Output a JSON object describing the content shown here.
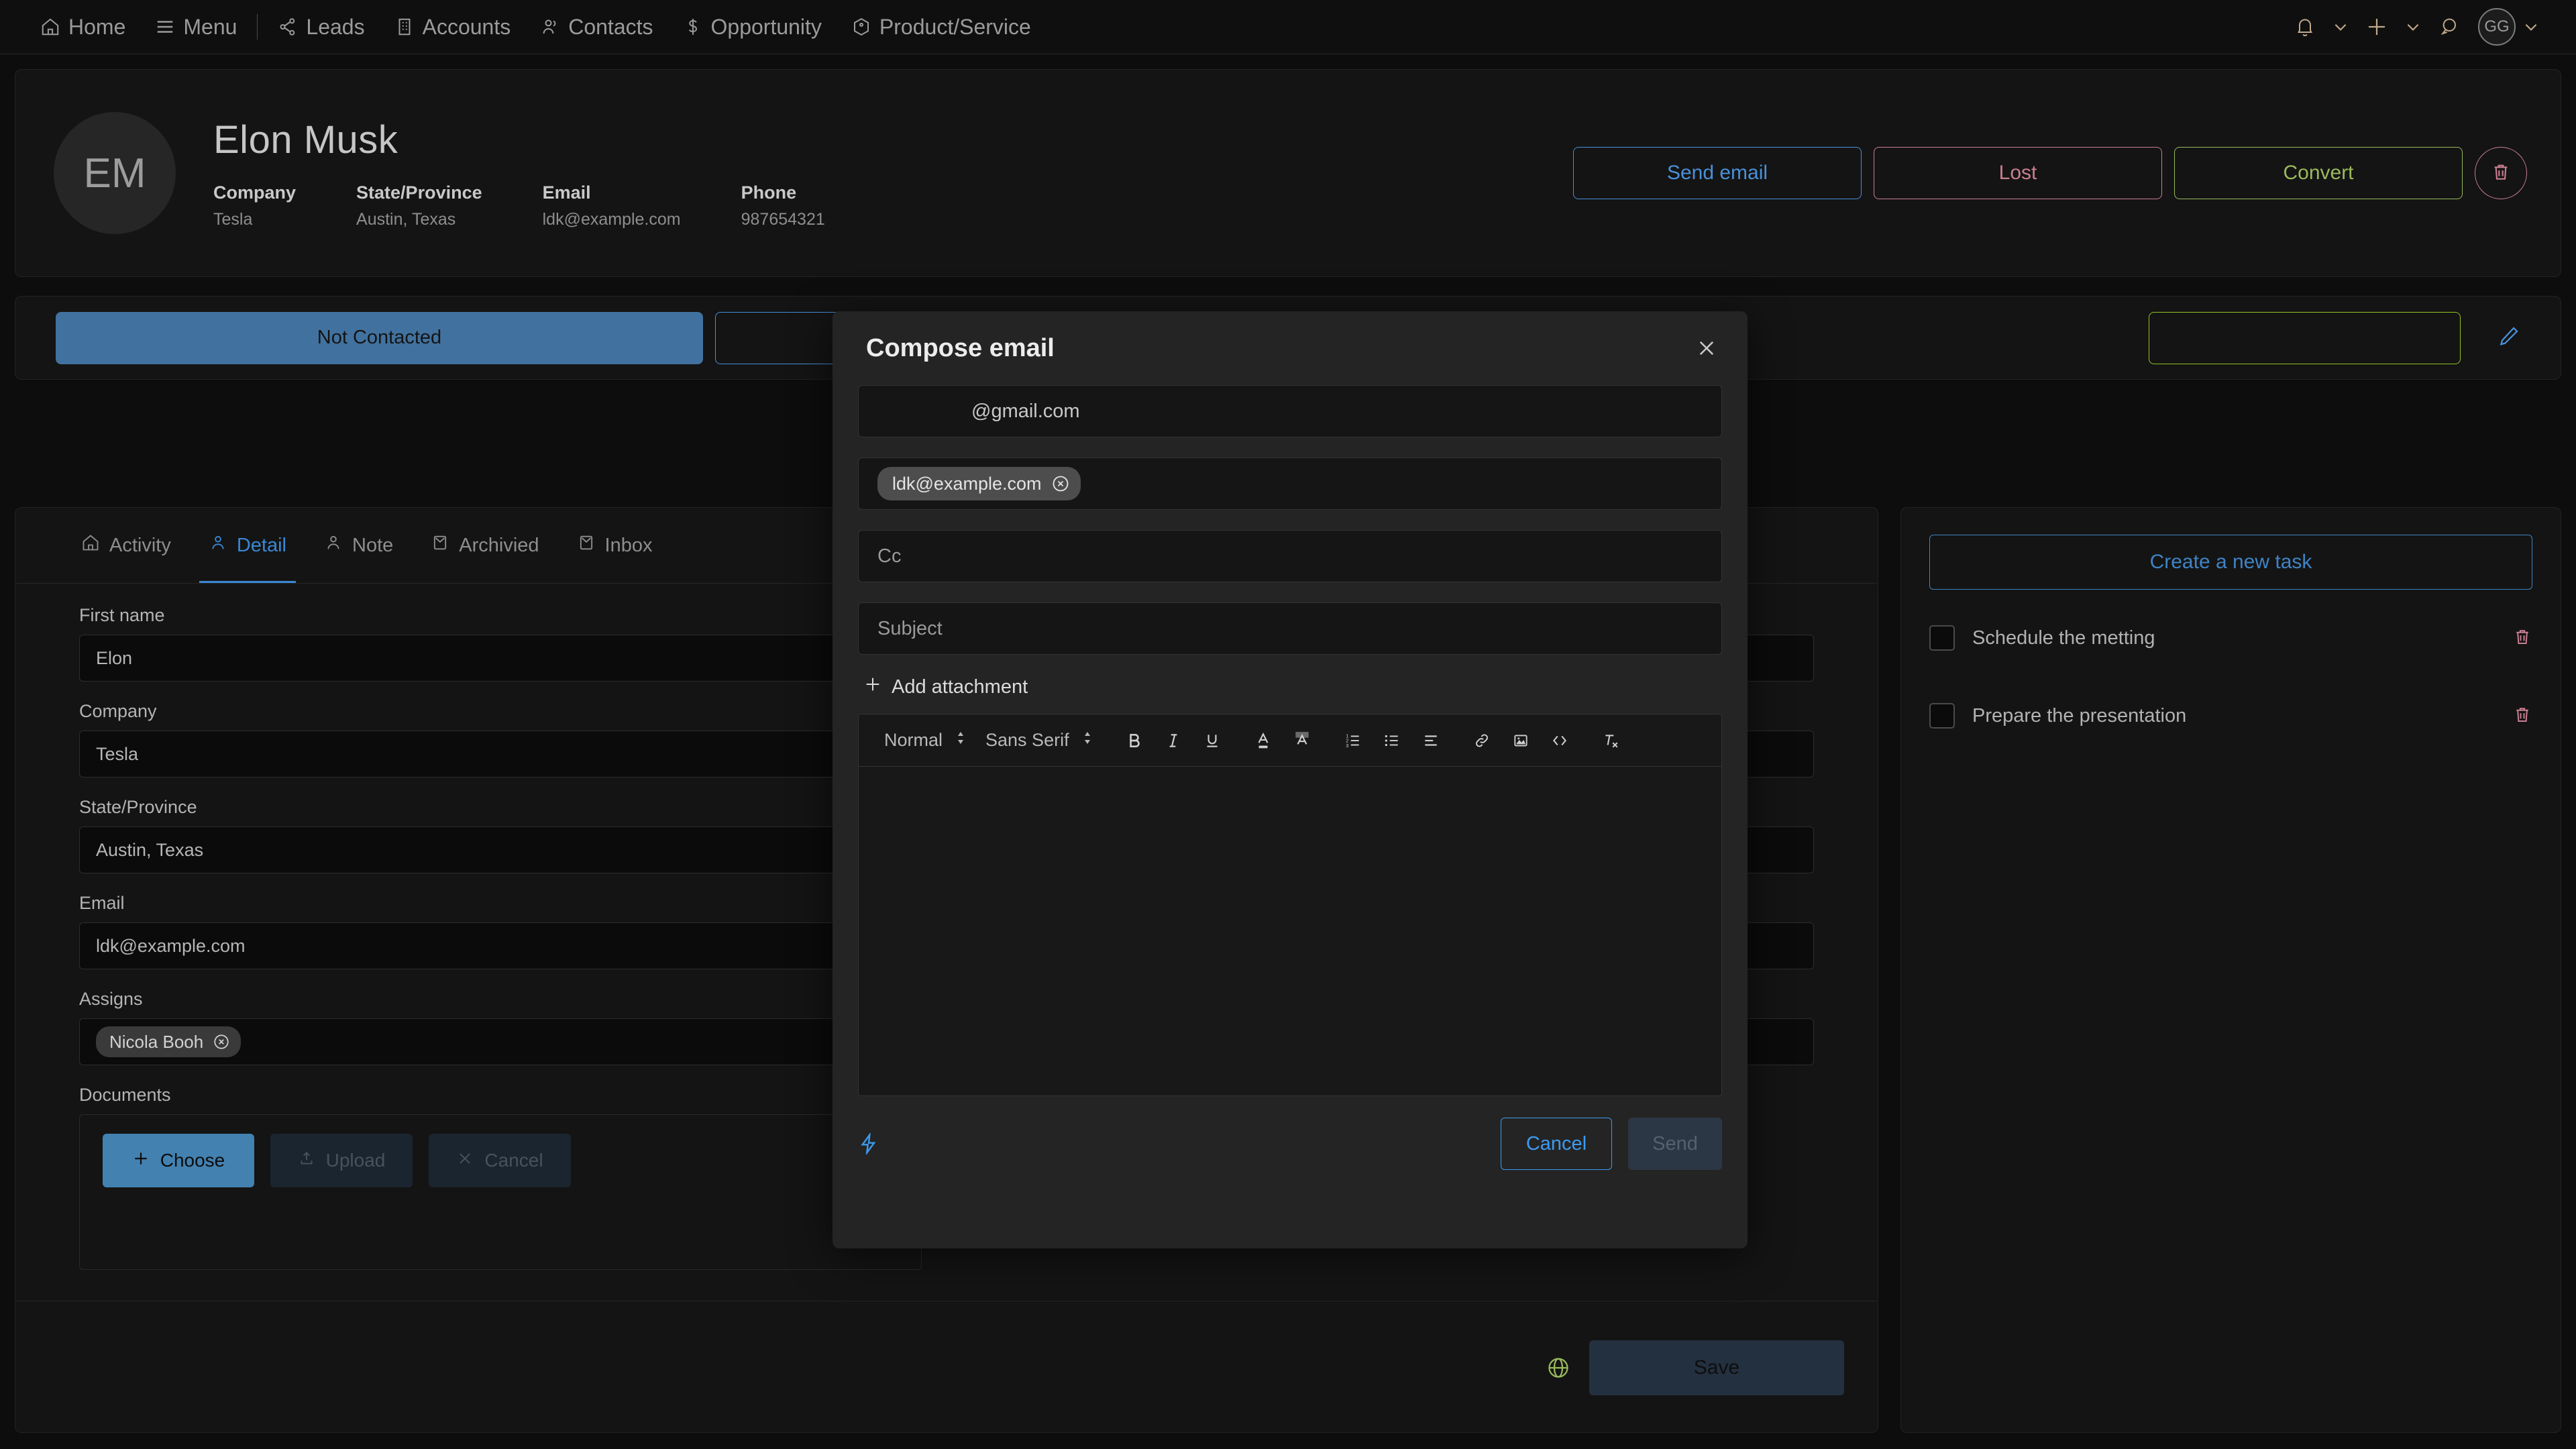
{
  "topnav": {
    "items": [
      {
        "label": "Home",
        "icon": "home-icon"
      },
      {
        "label": "Menu",
        "icon": "hamburger-icon"
      },
      {
        "label": "Leads",
        "icon": "share-nodes-icon"
      },
      {
        "label": "Accounts",
        "icon": "building-icon"
      },
      {
        "label": "Contacts",
        "icon": "users-icon"
      },
      {
        "label": "Opportunity",
        "icon": "dollar-icon"
      },
      {
        "label": "Product/Service",
        "icon": "box-icon"
      }
    ],
    "right": {
      "notifications_icon": "bell-icon",
      "add_icon": "plus-icon",
      "chat_icon": "chat-icon",
      "avatar_initials": "GG"
    }
  },
  "record": {
    "avatar_initials": "EM",
    "name": "Elon  Musk",
    "fields": [
      {
        "label": "Company",
        "value": "Tesla"
      },
      {
        "label": "State/Province",
        "value": "Austin, Texas"
      },
      {
        "label": "Email",
        "value": "ldk@example.com"
      },
      {
        "label": "Phone",
        "value": "987654321"
      }
    ],
    "actions": {
      "send_email": "Send email",
      "lost": "Lost",
      "convert": "Convert",
      "delete_icon": "trash-icon"
    }
  },
  "status": {
    "stages": [
      {
        "label": "Not Contacted",
        "state": "active"
      },
      {
        "label": "",
        "state": "next"
      },
      {
        "label": "",
        "state": "last"
      }
    ],
    "edit_icon": "pencil-icon"
  },
  "detail": {
    "tabs": [
      {
        "label": "Activity",
        "icon": "home-icon",
        "active": false
      },
      {
        "label": "Detail",
        "icon": "user-icon",
        "active": true
      },
      {
        "label": "Note",
        "icon": "user-icon",
        "active": false
      },
      {
        "label": "Archivied",
        "icon": "envelope-icon",
        "active": false
      },
      {
        "label": "Inbox",
        "icon": "envelope-icon",
        "active": false
      }
    ],
    "fields_left": [
      {
        "label": "First name",
        "value": "Elon"
      },
      {
        "label": "Company",
        "value": "Tesla"
      },
      {
        "label": "State/Province",
        "value": "Austin, Texas"
      },
      {
        "label": "Email",
        "value": "ldk@example.com"
      }
    ],
    "fields_right": [
      {
        "label": "",
        "value": ""
      },
      {
        "label": "",
        "value": ""
      },
      {
        "label": "",
        "value": ""
      },
      {
        "label": "",
        "value": ""
      }
    ],
    "assigns": {
      "label": "Assigns",
      "chip": "Nicola Booh",
      "chip_remove_icon": "circle-x-icon"
    },
    "documents": {
      "label": "Documents",
      "choose": "Choose",
      "upload": "Upload",
      "cancel": "Cancel"
    },
    "footer": {
      "globe_icon": "globe-icon",
      "save": "Save"
    }
  },
  "tasks": {
    "create_label": "Create a new task",
    "items": [
      {
        "label": "Schedule the metting",
        "checked": false,
        "delete_icon": "trash-icon"
      },
      {
        "label": "Prepare the presentation",
        "checked": false,
        "delete_icon": "trash-icon"
      }
    ]
  },
  "modal": {
    "title": "Compose email",
    "close_icon": "close-icon",
    "from": {
      "value": "@gmail.com"
    },
    "to": {
      "chip": "ldk@example.com",
      "chip_remove_icon": "circle-x-icon"
    },
    "cc": {
      "placeholder": "Cc",
      "value": "Cc"
    },
    "subject": {
      "placeholder": "Subject",
      "value": "Subject"
    },
    "add_attachment": "Add attachment",
    "toolbar": {
      "heading_select": "Normal",
      "font_select": "Sans Serif",
      "buttons": [
        "bold-icon",
        "italic-icon",
        "underline-icon",
        "font-color-icon",
        "highlight-icon",
        "ordered-list-icon",
        "bullet-list-icon",
        "align-icon",
        "link-icon",
        "image-icon",
        "code-icon",
        "clear-format-icon"
      ]
    },
    "body_value": "",
    "footer": {
      "bolt_icon": "bolt-icon",
      "cancel": "Cancel",
      "send": "Send"
    }
  },
  "colors": {
    "accent_blue": "#4a90d9",
    "danger_pink": "#c97f92",
    "success_green": "#9aba5c",
    "stage_fill": "#41729f",
    "bg": "#0d0d0d",
    "card": "#141414",
    "modal_bg": "#242424"
  }
}
